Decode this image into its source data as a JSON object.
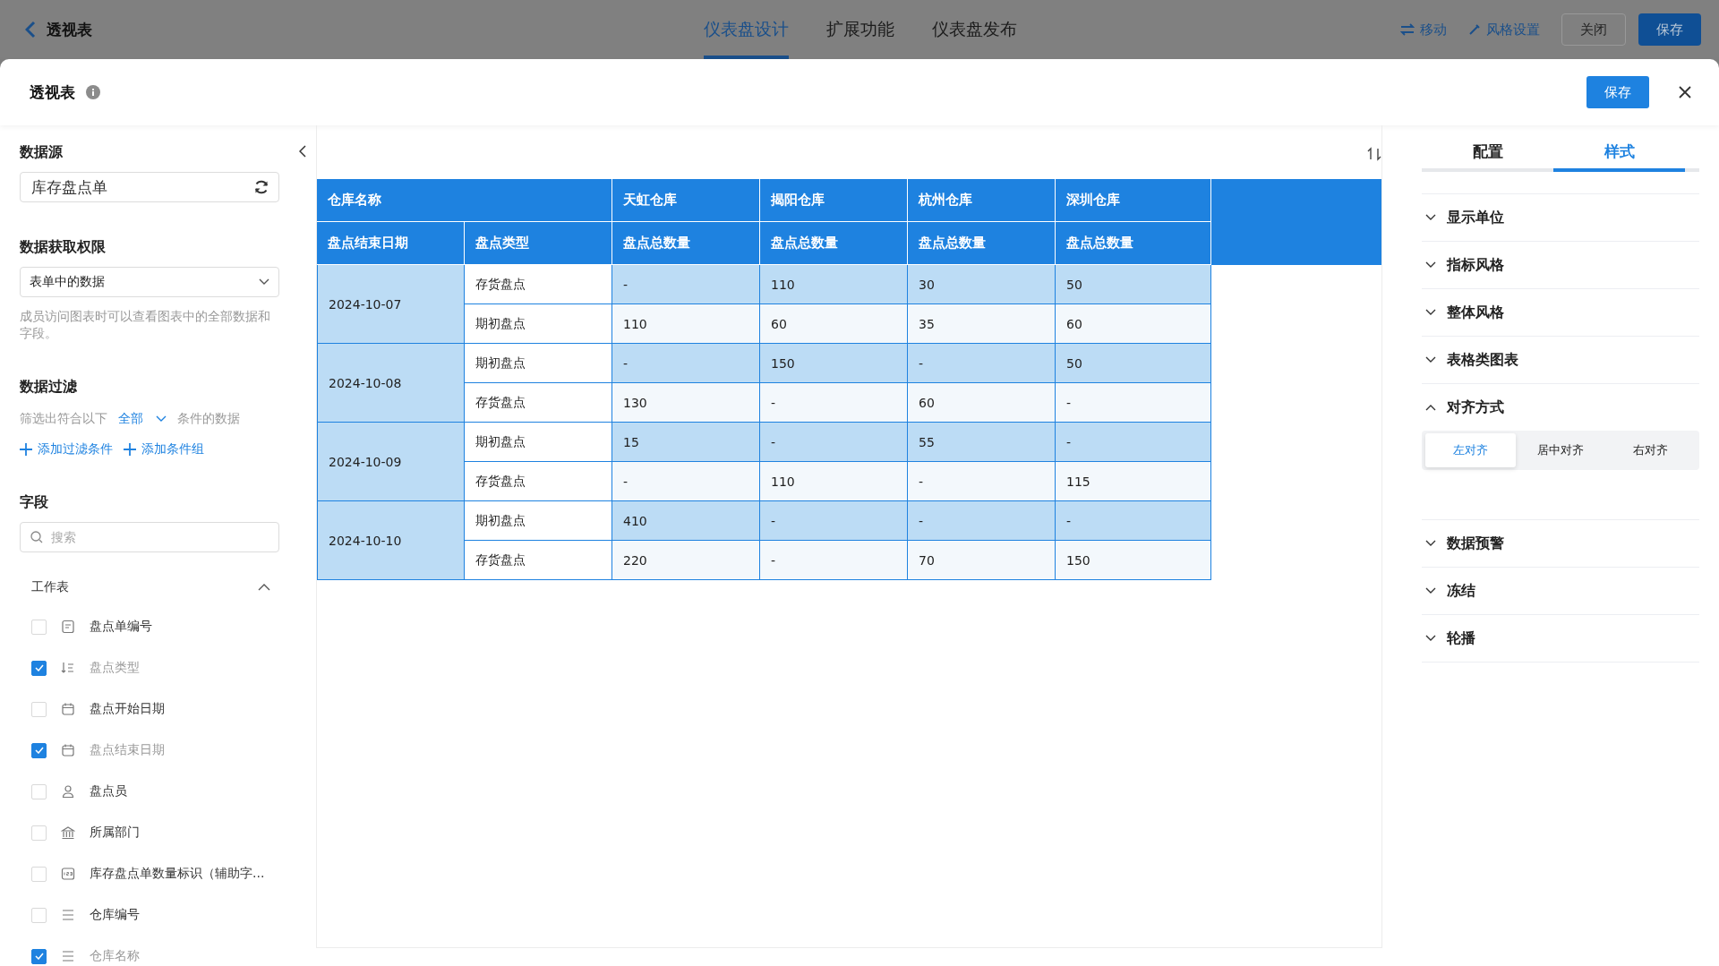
{
  "top_bar": {
    "back_title": "透视表",
    "tabs": [
      {
        "label": "仪表盘设计",
        "selected": true
      },
      {
        "label": "扩展功能",
        "selected": false
      },
      {
        "label": "仪表盘发布",
        "selected": false
      }
    ],
    "actions": [
      {
        "label": "移动",
        "kind": "move"
      },
      {
        "label": "风格设置",
        "kind": "style"
      }
    ],
    "buttons": [
      {
        "label": "关闭",
        "kind": "secondary"
      },
      {
        "label": "保存",
        "kind": "primary"
      }
    ]
  },
  "dialog": {
    "title": "透视表",
    "save": "保存"
  },
  "left_panel": {
    "data_source": {
      "title": "数据源",
      "value": "库存盘点单"
    },
    "permission": {
      "title": "数据获取权限",
      "value": "表单中的数据",
      "hint": "成员访问图表时可以查看图表中的全部数据和字段。"
    },
    "filter": {
      "title": "数据过滤",
      "prefix": "筛选出符合以下",
      "mode": "全部",
      "suffix": "条件的数据",
      "add_condition": "添加过滤条件",
      "add_group": "添加条件组"
    },
    "fields": {
      "title": "字段",
      "placeholder": "搜索",
      "group": {
        "label": "工作表",
        "expanded": true
      },
      "items": [
        {
          "label": "盘点单编号",
          "checked": false,
          "kind": "serial"
        },
        {
          "label": "盘点类型",
          "checked": true,
          "kind": "sort"
        },
        {
          "label": "盘点开始日期",
          "checked": false,
          "kind": "date"
        },
        {
          "label": "盘点结束日期",
          "checked": true,
          "kind": "date"
        },
        {
          "label": "盘点员",
          "checked": false,
          "kind": "person"
        },
        {
          "label": "所属部门",
          "checked": false,
          "kind": "department"
        },
        {
          "label": "库存盘点单数量标识（辅助字...",
          "checked": false,
          "kind": "number"
        },
        {
          "label": "仓库编号",
          "checked": false,
          "kind": "text"
        },
        {
          "label": "仓库名称",
          "checked": true,
          "kind": "text"
        }
      ]
    }
  },
  "table": {
    "corner": "仓库名称",
    "warehouses": [
      "天虹仓库",
      "揭阳仓库",
      "杭州仓库",
      "深圳仓库"
    ],
    "row_headers": [
      "盘点结束日期",
      "盘点类型"
    ],
    "measures": [
      "盘点总数量",
      "盘点总数量",
      "盘点总数量",
      "盘点总数量"
    ],
    "groups": [
      {
        "date": "2024-10-07",
        "rows": [
          {
            "type": "存货盘点",
            "values": [
              "-",
              "110",
              "30",
              "50"
            ]
          },
          {
            "type": "期初盘点",
            "values": [
              "110",
              "60",
              "35",
              "60"
            ]
          }
        ]
      },
      {
        "date": "2024-10-08",
        "rows": [
          {
            "type": "期初盘点",
            "values": [
              "-",
              "150",
              "-",
              "50"
            ]
          },
          {
            "type": "存货盘点",
            "values": [
              "130",
              "-",
              "60",
              "-"
            ]
          }
        ]
      },
      {
        "date": "2024-10-09",
        "rows": [
          {
            "type": "期初盘点",
            "values": [
              "15",
              "-",
              "55",
              "-"
            ]
          },
          {
            "type": "存货盘点",
            "values": [
              "-",
              "110",
              "-",
              "115"
            ]
          }
        ]
      },
      {
        "date": "2024-10-10",
        "rows": [
          {
            "type": "期初盘点",
            "values": [
              "410",
              "-",
              "-",
              "-"
            ]
          },
          {
            "type": "存货盘点",
            "values": [
              "220",
              "-",
              "70",
              "150"
            ]
          }
        ]
      }
    ]
  },
  "right_panel": {
    "tabs": [
      {
        "label": "配置",
        "selected": false
      },
      {
        "label": "样式",
        "selected": true
      }
    ],
    "sections": [
      {
        "title": "显示单位",
        "expanded": false
      },
      {
        "title": "指标风格",
        "expanded": false
      },
      {
        "title": "整体风格",
        "expanded": false
      },
      {
        "title": "表格类图表",
        "expanded": false
      },
      {
        "title": "对齐方式",
        "expanded": true,
        "options": [
          {
            "label": "左对齐",
            "selected": true
          },
          {
            "label": "居中对齐",
            "selected": false
          },
          {
            "label": "右对齐",
            "selected": false
          }
        ]
      },
      {
        "title": "数据预警",
        "expanded": false
      },
      {
        "title": "冻结",
        "expanded": false
      },
      {
        "title": "轮播",
        "expanded": false
      }
    ]
  }
}
